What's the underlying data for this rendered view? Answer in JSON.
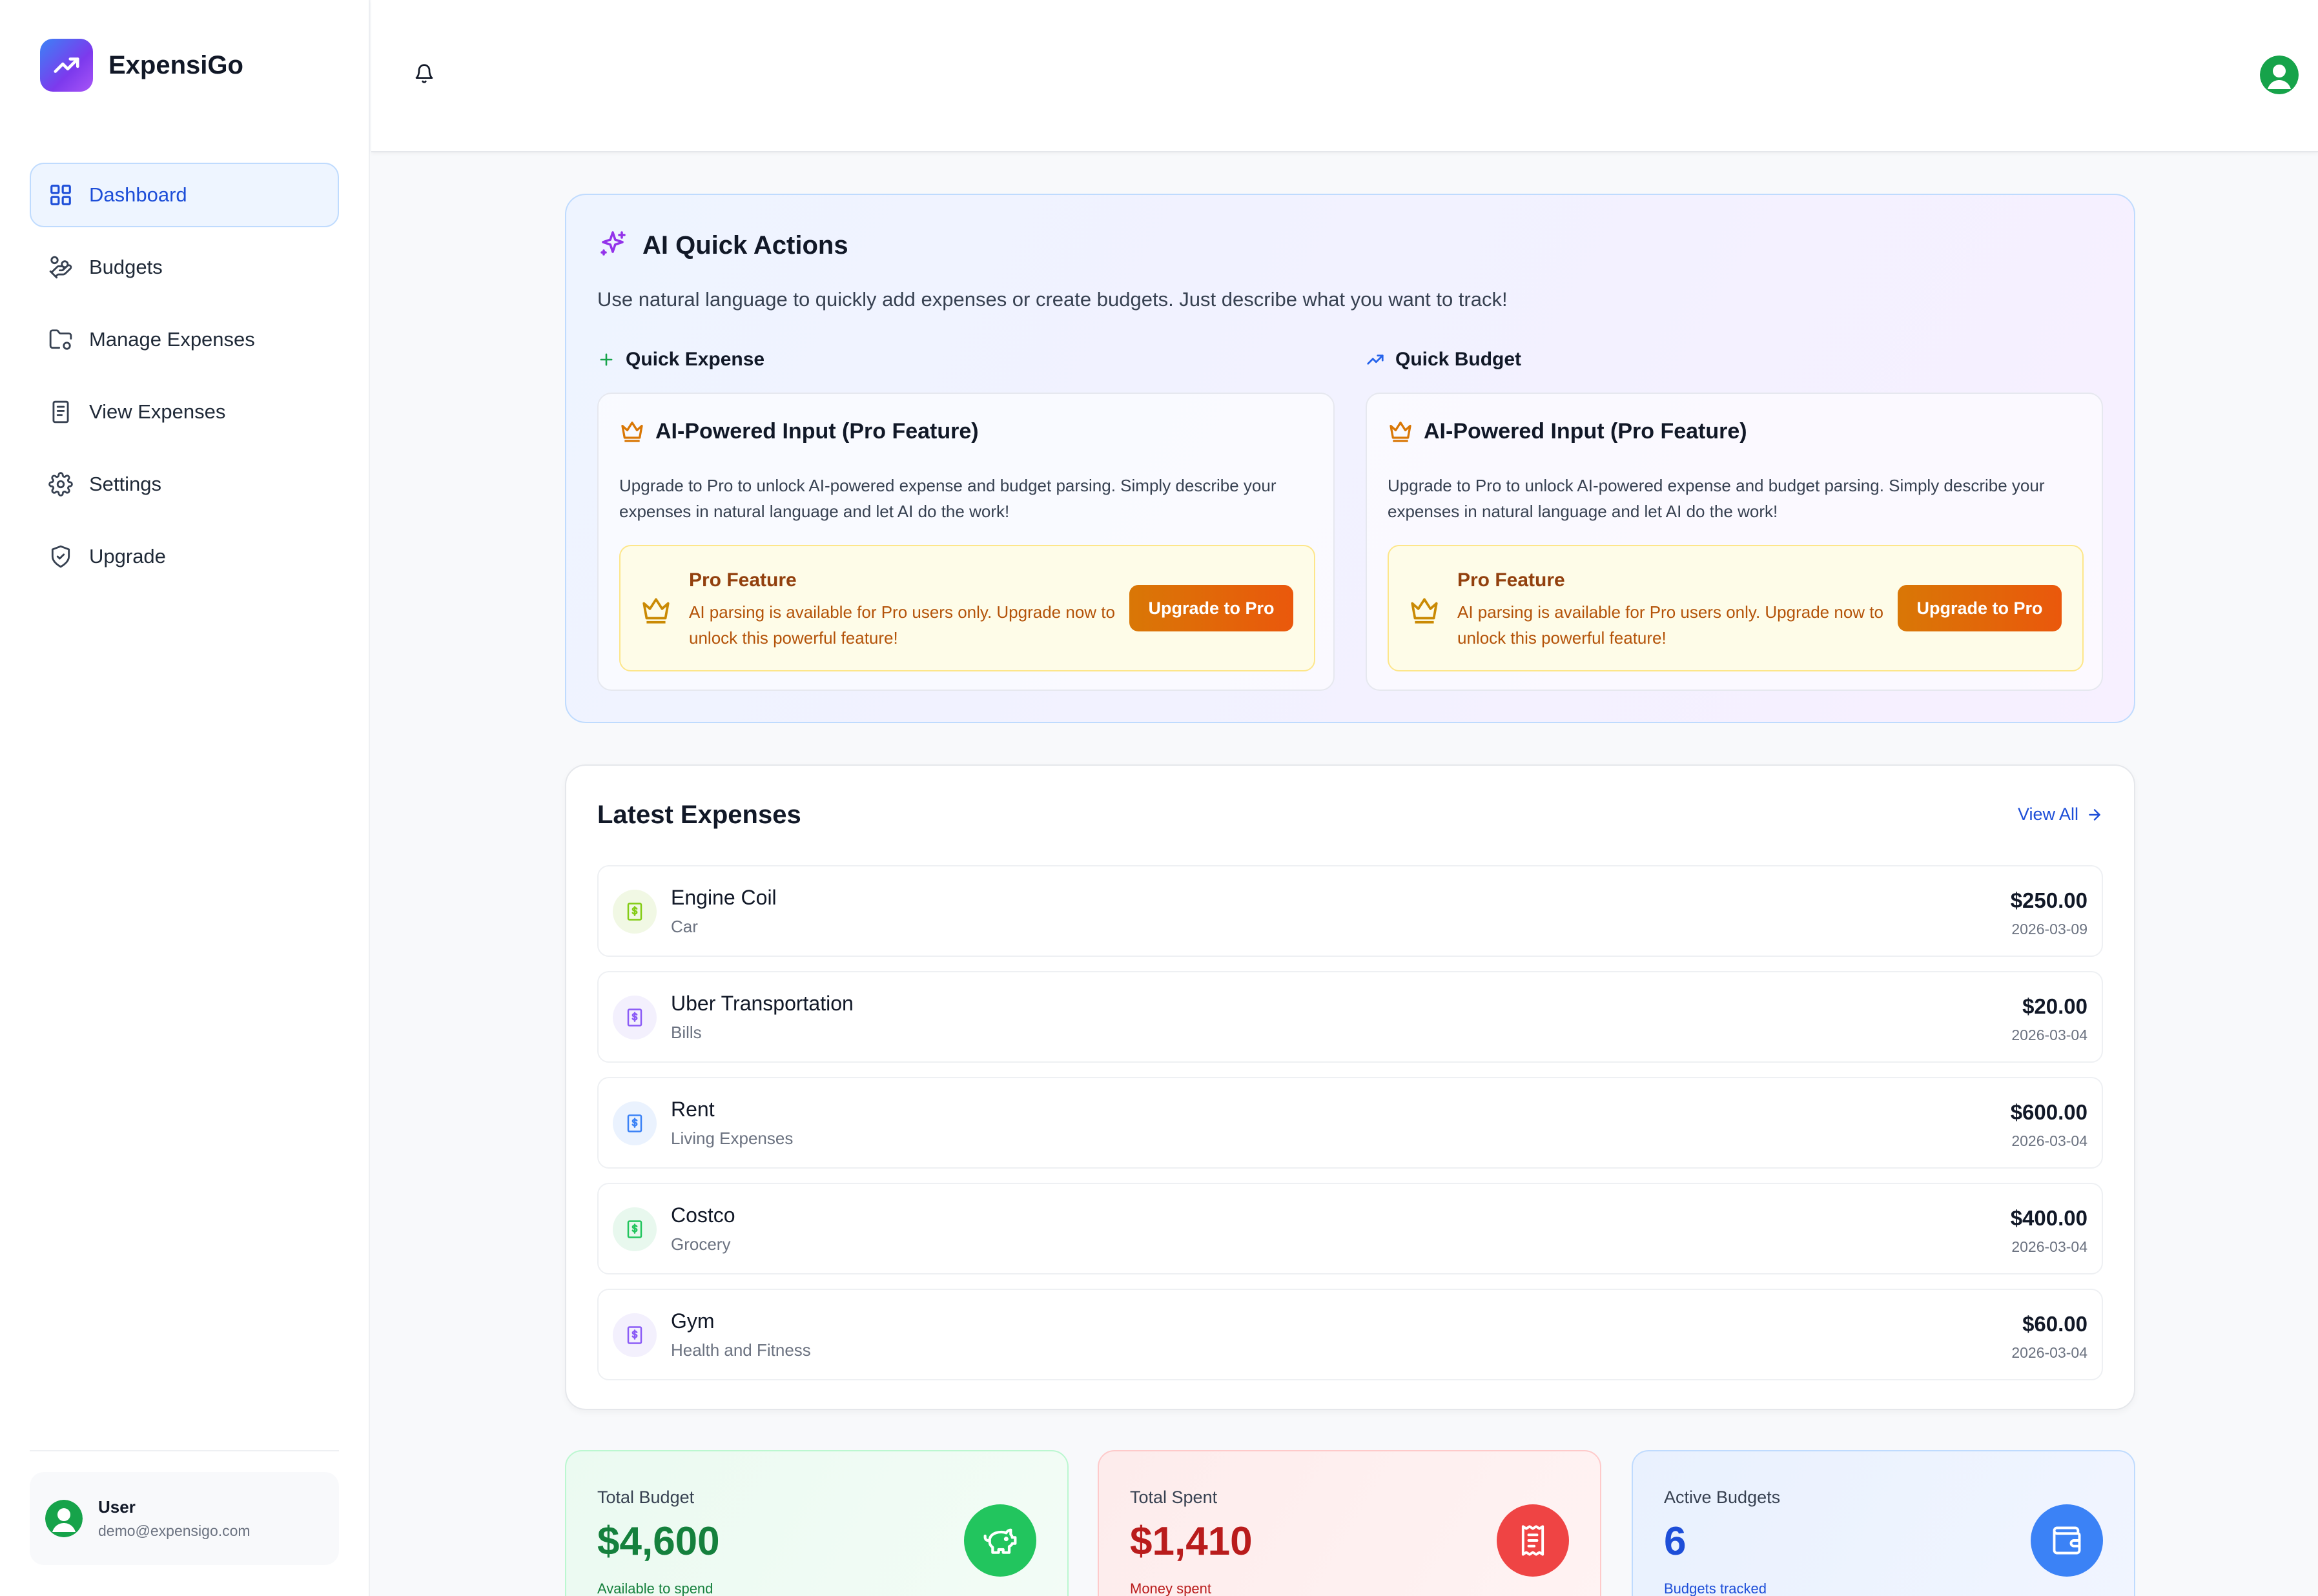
{
  "app": {
    "name": "ExpensiGo"
  },
  "sidebar": {
    "items": [
      {
        "label": "Dashboard",
        "icon": "grid-icon",
        "active": true
      },
      {
        "label": "Budgets",
        "icon": "hand-coins-icon"
      },
      {
        "label": "Manage Expenses",
        "icon": "folder-cog-icon"
      },
      {
        "label": "View Expenses",
        "icon": "receipt-icon"
      },
      {
        "label": "Settings",
        "icon": "gear-icon"
      },
      {
        "label": "Upgrade",
        "icon": "shield-check-icon"
      }
    ],
    "user": {
      "name": "User",
      "email": "demo@expensigo.com"
    }
  },
  "ai": {
    "title": "AI Quick Actions",
    "description": "Use natural language to quickly add expenses or create budgets. Just describe what you want to track!",
    "quick_expense": {
      "label": "Quick Expense",
      "card_title": "AI-Powered Input (Pro Feature)",
      "card_desc": "Upgrade to Pro to unlock AI-powered expense and budget parsing. Simply describe your expenses in natural language and let AI do the work!",
      "pro_title": "Pro Feature",
      "pro_text": "AI parsing is available for Pro users only. Upgrade now to unlock this powerful feature!",
      "button": "Upgrade to Pro"
    },
    "quick_budget": {
      "label": "Quick Budget",
      "card_title": "AI-Powered Input (Pro Feature)",
      "card_desc": "Upgrade to Pro to unlock AI-powered expense and budget parsing. Simply describe your expenses in natural language and let AI do the work!",
      "pro_title": "Pro Feature",
      "pro_text": "AI parsing is available for Pro users only. Upgrade now to unlock this powerful feature!",
      "button": "Upgrade to Pro"
    }
  },
  "expenses": {
    "title": "Latest Expenses",
    "view_all": "View All",
    "items": [
      {
        "name": "Engine Coil",
        "category": "Car",
        "amount": "$250.00",
        "date": "2026-03-09",
        "color": "#84cc16"
      },
      {
        "name": "Uber Transportation",
        "category": "Bills",
        "amount": "$20.00",
        "date": "2026-03-04",
        "color": "#8b5cf6"
      },
      {
        "name": "Rent",
        "category": "Living Expenses",
        "amount": "$600.00",
        "date": "2026-03-04",
        "color": "#3b82f6"
      },
      {
        "name": "Costco",
        "category": "Grocery",
        "amount": "$400.00",
        "date": "2026-03-04",
        "color": "#22c55e"
      },
      {
        "name": "Gym",
        "category": "Health and Fitness",
        "amount": "$60.00",
        "date": "2026-03-04",
        "color": "#8b5cf6"
      }
    ]
  },
  "stats": {
    "total_budget": {
      "label": "Total Budget",
      "value": "$4,600",
      "sub": "Available to spend",
      "color": "#15803d",
      "icon": "piggy-bank-icon"
    },
    "total_spent": {
      "label": "Total Spent",
      "value": "$1,410",
      "sub": "Money spent",
      "color": "#b91c1c",
      "icon": "receipt-icon"
    },
    "active_budgets": {
      "label": "Active Budgets",
      "value": "6",
      "sub": "Budgets tracked",
      "color": "#1d4ed8",
      "icon": "wallet-icon"
    }
  }
}
